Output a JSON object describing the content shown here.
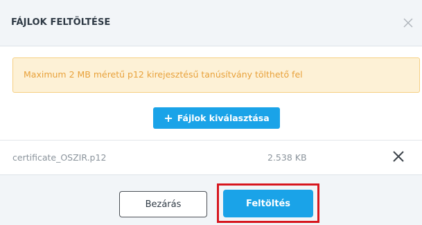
{
  "dialog": {
    "title": "FÁJLOK FELTÖLTÉSE",
    "close_icon": "close-icon"
  },
  "alert": {
    "text": "Maximum 2 MB méretű p12 kirejesztésű tanúsítvány tölthető fel",
    "color": "#e8a13a"
  },
  "select_button": {
    "icon": "plus-icon",
    "label": "Fájlok kiválasztása"
  },
  "files": [
    {
      "name": "certificate_OSZIR.p12",
      "size": "2.538 KB",
      "remove_icon": "close-icon"
    }
  ],
  "footer": {
    "close_label": "Bezárás",
    "upload_label": "Feltöltés"
  },
  "colors": {
    "primary": "#1aa3e8",
    "highlight": "#d7161e",
    "alert_bg": "#fdf1d6"
  }
}
